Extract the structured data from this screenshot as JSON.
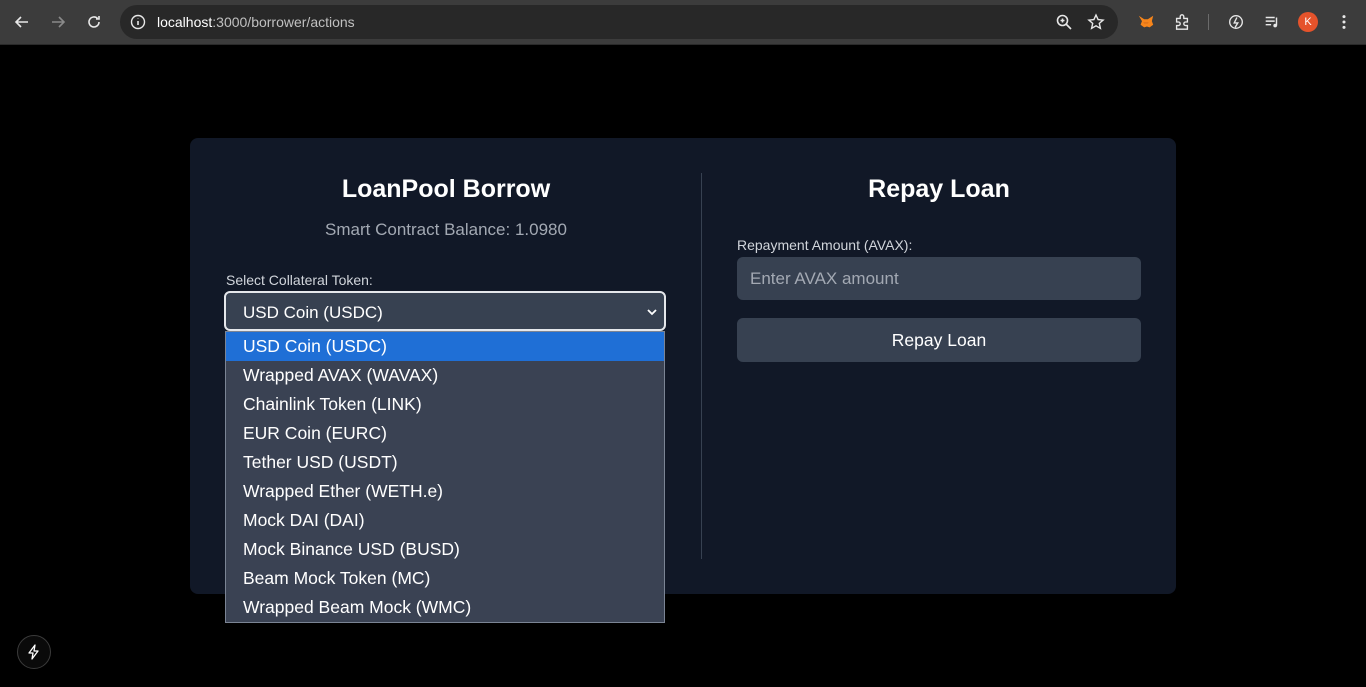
{
  "browser": {
    "url_host": "localhost",
    "url_rest": ":3000/borrower/actions",
    "avatar_letter": "K",
    "icons": [
      "back-arrow-icon",
      "forward-arrow-icon",
      "reload-icon",
      "info-icon",
      "zoom-icon",
      "star-icon",
      "metamask-fox-icon",
      "extensions-puzzle-icon",
      "performance-icon",
      "media-queue-icon",
      "menu-dots-icon"
    ]
  },
  "borrow": {
    "title": "LoanPool Borrow",
    "balance": "Smart Contract Balance: 1.0980",
    "collateral_label": "Select Collateral Token:",
    "selected_token": "USD Coin (USDC)",
    "options": [
      "USD Coin (USDC)",
      "Wrapped AVAX (WAVAX)",
      "Chainlink Token (LINK)",
      "EUR Coin (EURC)",
      "Tether USD (USDT)",
      "Wrapped Ether (WETH.e)",
      "Mock DAI (DAI)",
      "Mock Binance USD (BUSD)",
      "Beam Mock Token (MC)",
      "Wrapped Beam Mock (WMC)"
    ]
  },
  "repay": {
    "title": "Repay Loan",
    "amount_label": "Repayment Amount (AVAX):",
    "amount_placeholder": "Enter AVAX amount",
    "amount_value": "",
    "button_label": "Repay Loan"
  },
  "colors": {
    "page_bg": "#000000",
    "card_bg": "#111827",
    "field_bg": "#374151",
    "option_selected": "#1f6fd6"
  }
}
